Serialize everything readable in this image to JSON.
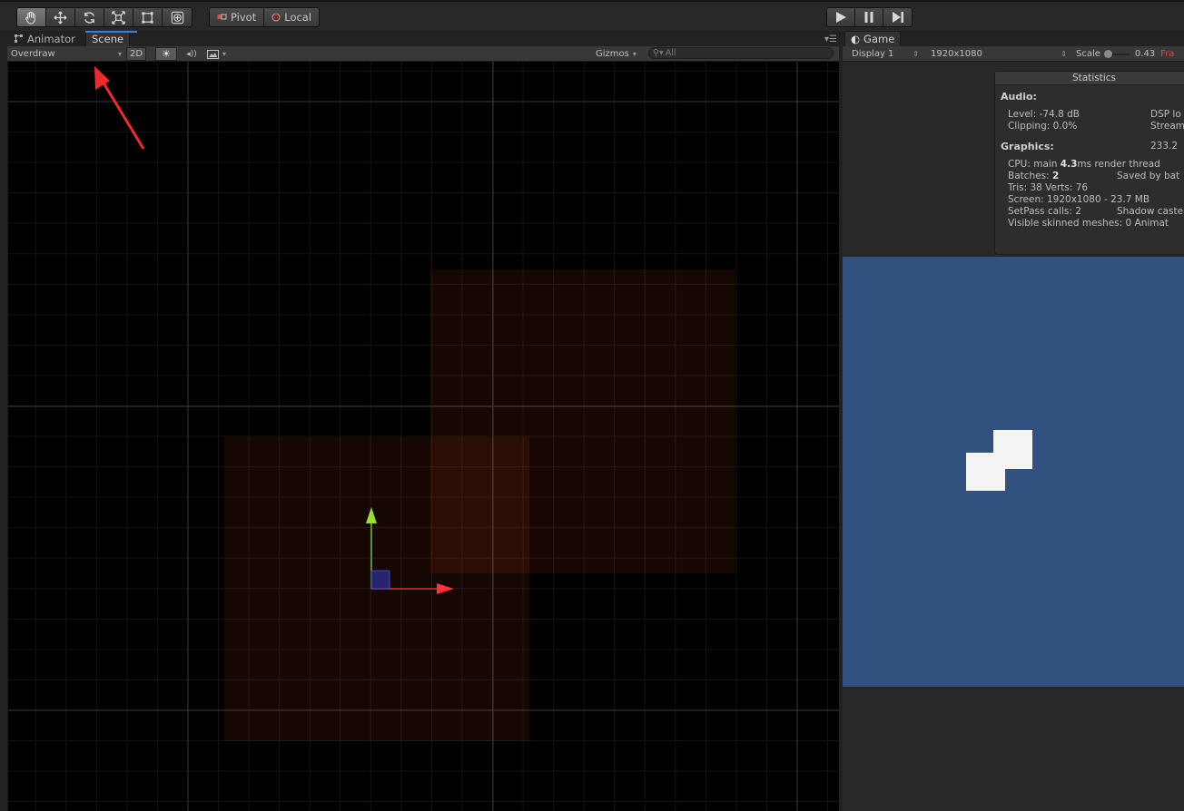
{
  "toolbar": {
    "transform_tools": [
      {
        "name": "hand-icon",
        "active": true
      },
      {
        "name": "move-icon",
        "active": false
      },
      {
        "name": "rotate-icon",
        "active": false
      },
      {
        "name": "scale-icon",
        "active": false
      },
      {
        "name": "rect-tool-icon",
        "active": false
      },
      {
        "name": "transform-tool-icon",
        "active": false
      }
    ],
    "pivot_label": "Pivot",
    "local_label": "Local",
    "play_controls": [
      "play-icon",
      "pause-icon",
      "step-icon"
    ]
  },
  "scene_panel": {
    "tabs": [
      {
        "label": "Animator",
        "active": false
      },
      {
        "label": "Scene",
        "active": true
      }
    ],
    "draw_mode": "Overdraw",
    "mode_2d_label": "2D",
    "gizmos_label": "Gizmos",
    "search_placeholder": "All",
    "menu_icon": "panel-menu-icon",
    "background_color": "#000000",
    "overdraw_color": "#ff5020",
    "x_axis_color": "#ff3333",
    "y_axis_color": "#99dd33"
  },
  "game_panel": {
    "tab_label": "Game",
    "display_label": "Display 1",
    "resolution_label": "1920x1080",
    "scale_label": "Scale",
    "scale_value": "0.43",
    "frame_label_fragment": "Fra",
    "camera_background": "#31517f",
    "statistics": {
      "title": "Statistics",
      "audio_heading": "Audio:",
      "level_text": "Level: -74.8 dB",
      "clipping_text": "Clipping: 0.0%",
      "dsp_text": "DSP lo",
      "stream_text": "Stream",
      "graphics_heading": "Graphics:",
      "fps_text": "233.2",
      "cpu_prefix": "CPU: main ",
      "cpu_main": "4.3",
      "cpu_suffix": "ms  render thread",
      "batches_prefix": "Batches: ",
      "batches_value": "2",
      "saved_text": "Saved by bat",
      "tris_text": "Tris: 38   Verts: 76",
      "screen_text": "Screen: 1920x1080 - 23.7 MB",
      "setpass_text": "SetPass calls: 2",
      "shadow_text": "Shadow caste",
      "skinned_text": "Visible skinned meshes: 0  Animat"
    }
  }
}
